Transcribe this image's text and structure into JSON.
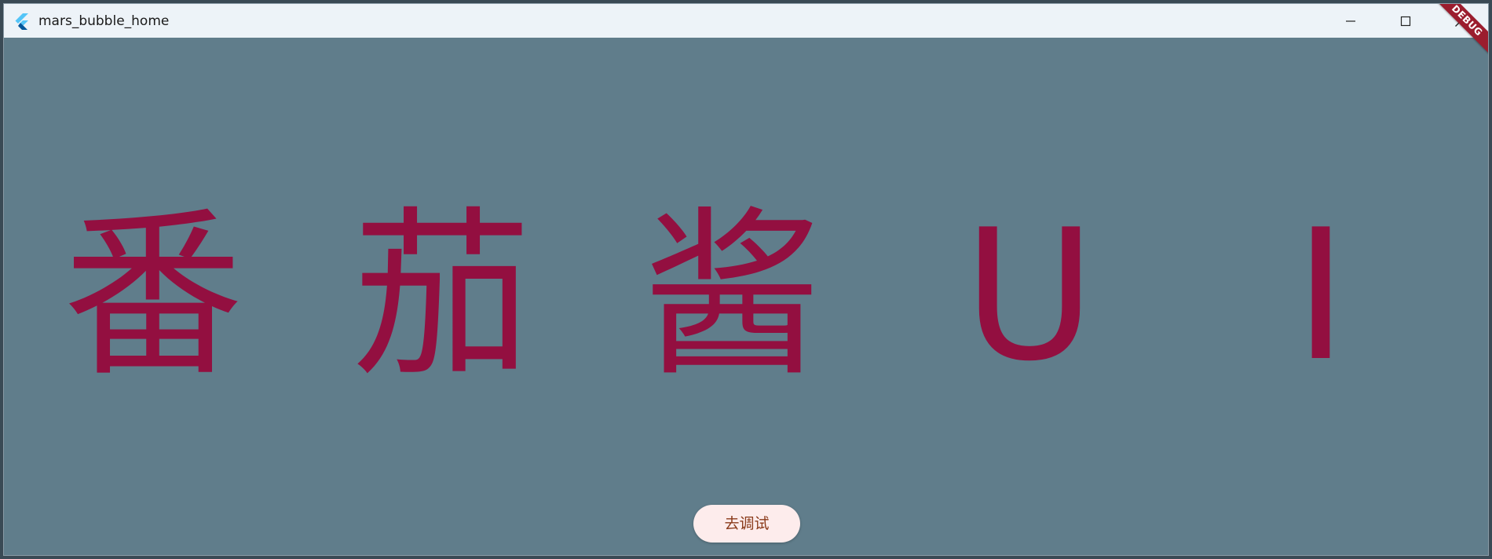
{
  "window": {
    "title": "mars_bubble_home",
    "controls": {
      "minimize": "minimize-icon",
      "maximize": "maximize-icon",
      "close": "close-icon"
    }
  },
  "main": {
    "headline_chars": [
      "番",
      "茄",
      "酱",
      "U",
      "I"
    ],
    "text_color": "#930f40",
    "background_color": "#607d8b",
    "debug_banner": "DEBUG",
    "action_button_label": "去调试"
  }
}
